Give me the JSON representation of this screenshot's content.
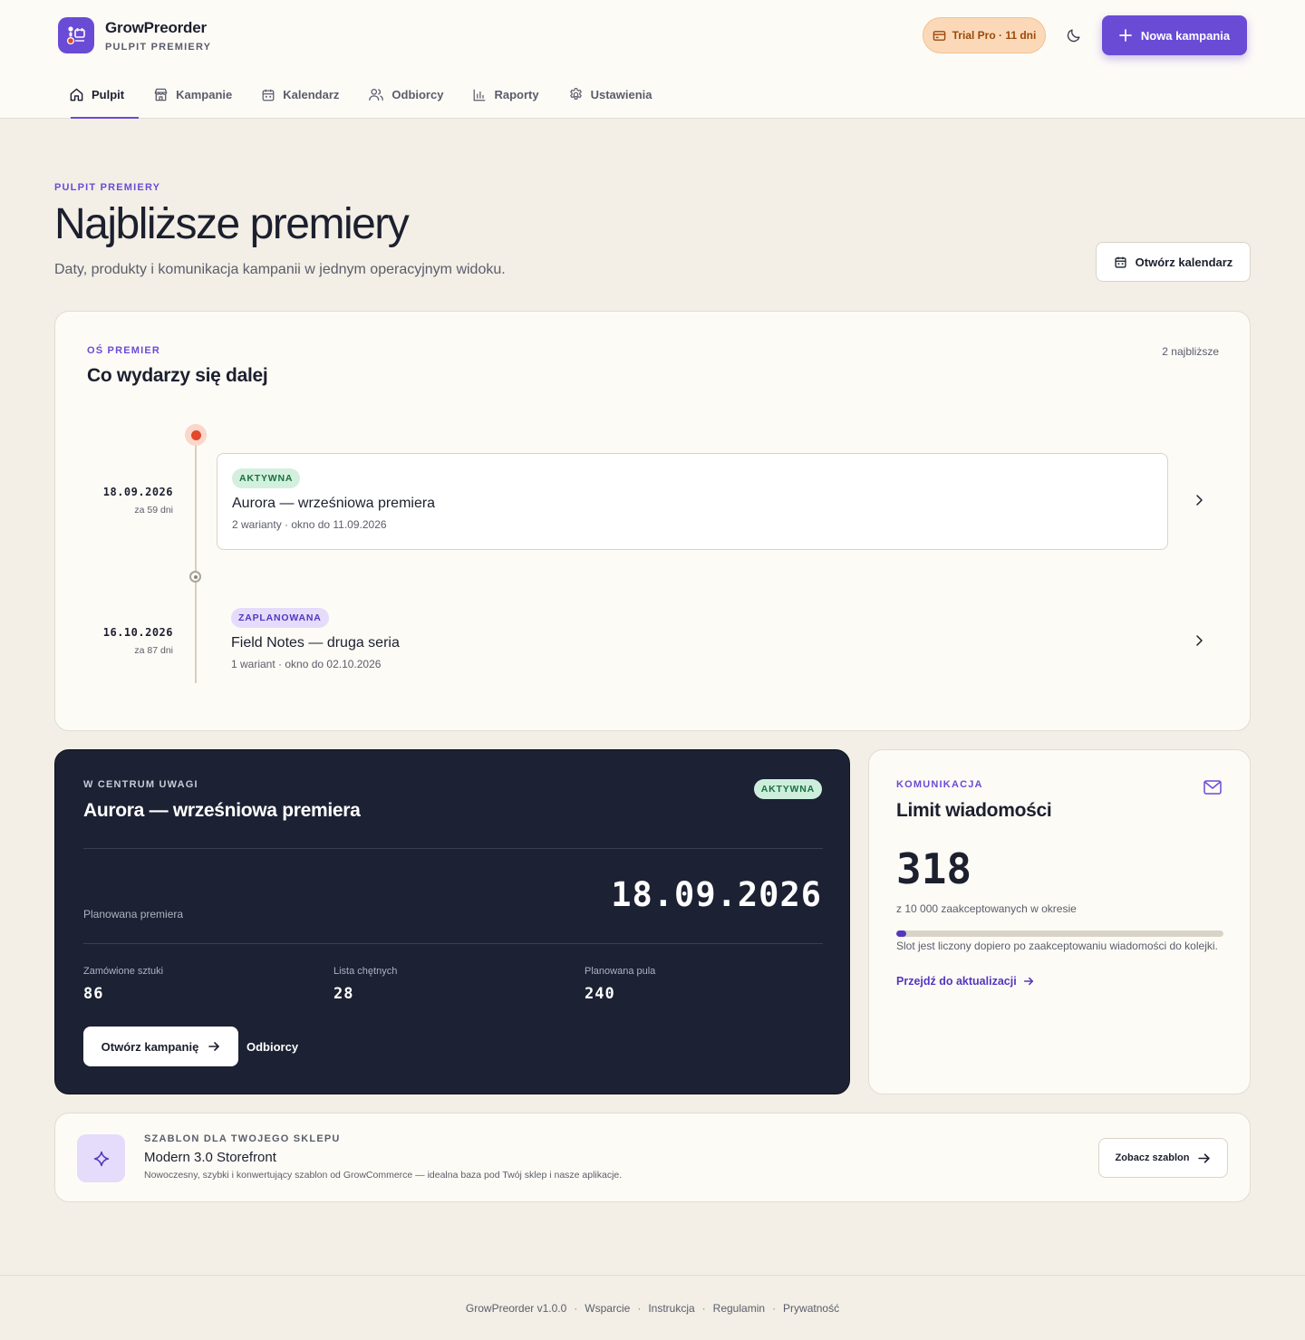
{
  "brand": {
    "name": "GrowPreorder",
    "subtitle": "PULPIT PREMIERY"
  },
  "header": {
    "trial_label": "Trial Pro · 11 dni",
    "new_campaign_label": "Nowa kampania"
  },
  "nav": [
    {
      "label": "Pulpit",
      "icon": "home-icon",
      "active": true
    },
    {
      "label": "Kampanie",
      "icon": "store-icon",
      "active": false
    },
    {
      "label": "Kalendarz",
      "icon": "calendar-icon",
      "active": false
    },
    {
      "label": "Odbiorcy",
      "icon": "users-icon",
      "active": false
    },
    {
      "label": "Raporty",
      "icon": "bar-chart-icon",
      "active": false
    },
    {
      "label": "Ustawienia",
      "icon": "gear-icon",
      "active": false
    }
  ],
  "page": {
    "eyebrow": "PULPIT PREMIERY",
    "title": "Najbliższe premiery",
    "subtitle": "Daty, produkty i komunikacja kampanii w jednym operacyjnym widoku.",
    "open_calendar_label": "Otwórz kalendarz"
  },
  "timeline": {
    "eyebrow": "OŚ PREMIER",
    "title": "Co wydarzy się dalej",
    "count": "2 najbliższe",
    "events": [
      {
        "date": "18.09.2026",
        "relative": "za 59 dni",
        "status": "AKTYWNA",
        "title": "Aurora — wrześniowa premiera",
        "meta": "2 warianty · okno do 11.09.2026"
      },
      {
        "date": "16.10.2026",
        "relative": "za 87 dni",
        "status": "ZAPLANOWANA",
        "title": "Field Notes — druga seria",
        "meta": "1 wariant · okno do 02.10.2026"
      }
    ]
  },
  "spotlight": {
    "eyebrow": "W CENTRUM UWAGI",
    "title": "Aurora — wrześniowa premiera",
    "status": "AKTYWNA",
    "date_label": "Planowana premiera",
    "date": "18.09.2026",
    "stats": [
      {
        "label": "Zamówione sztuki",
        "value": "86"
      },
      {
        "label": "Lista chętnych",
        "value": "28"
      },
      {
        "label": "Planowana pula",
        "value": "240"
      }
    ],
    "open_label": "Otwórz kampanię",
    "recipients_label": "Odbiorcy"
  },
  "communication": {
    "eyebrow": "KOMUNIKACJA",
    "title": "Limit wiadomości",
    "value": "318",
    "of_text": "z 10 000 zaakceptowanych w okresie",
    "usage_fraction": 0.0318,
    "note": "Slot jest liczony dopiero po zaakceptowaniu wiadomości do kolejki.",
    "link_label": "Przejdź do aktualizacji"
  },
  "template": {
    "eyebrow": "SZABLON DLA TWOJEGO SKLEPU",
    "title": "Modern 3.0 Storefront",
    "description": "Nowoczesny, szybki i konwertujący szablon od GrowCommerce — idealna baza pod Twój sklep i nasze aplikacje.",
    "button_label": "Zobacz szablon"
  },
  "footer": {
    "links": [
      "GrowPreorder v1.0.0",
      "Wsparcie",
      "Instrukcja",
      "Regulamin",
      "Prywatność"
    ]
  },
  "colors": {
    "accent": "#6a4bd6",
    "accent_dark": "#5436c0",
    "background": "#f3efe6",
    "surface": "#fdfbf6",
    "spotlight_bg": "#1c2133",
    "active_green": "#16713e",
    "timeline_active_dot": "#e0492b",
    "trial_bg": "#fbd9b8"
  }
}
